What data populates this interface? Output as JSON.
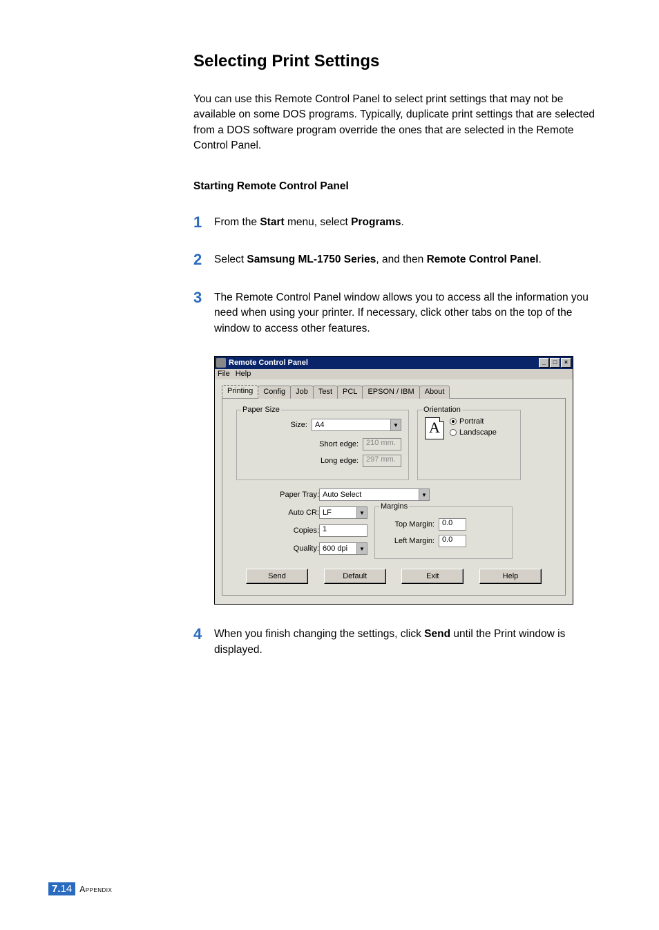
{
  "heading": "Selecting Print Settings",
  "intro": "You can use this Remote Control Panel to select print settings that may not be available on some DOS programs. Typically, duplicate print settings that are selected from a DOS software program override the ones that are selected in the Remote Control Panel.",
  "subheading": "Starting Remote Control Panel",
  "steps": {
    "s1": {
      "num": "1",
      "pre": "From the ",
      "b1": "Start",
      "mid": " menu, select ",
      "b2": "Programs",
      "post": "."
    },
    "s2": {
      "num": "2",
      "pre": "Select ",
      "b1": "Samsung ML-1750 Series",
      "mid": ", and then ",
      "b2": "Remote Control Panel",
      "post": "."
    },
    "s3": {
      "num": "3",
      "text": "The Remote Control Panel window allows you to access all the information you need when using your printer. If necessary, click other tabs on the top of the window to access other features."
    },
    "s4": {
      "num": "4",
      "pre": "When you finish changing the settings, click ",
      "b1": "Send",
      "post": " until the Print window is displayed."
    }
  },
  "rcp": {
    "title": "Remote Control Panel",
    "menu": {
      "file": "File",
      "help": "Help"
    },
    "tabs": [
      "Printing",
      "Config",
      "Job",
      "Test",
      "PCL",
      "EPSON / IBM",
      "About"
    ],
    "papersize": {
      "legend": "Paper Size",
      "size_label": "Size:",
      "size_value": "A4",
      "short_label": "Short edge:",
      "short_value": "210 mm.",
      "long_label": "Long edge:",
      "long_value": "297 mm."
    },
    "orientation": {
      "legend": "Orientation",
      "preview": "A",
      "portrait": "Portrait",
      "landscape": "Landscape"
    },
    "paper_tray": {
      "label": "Paper Tray:",
      "value": "Auto Select"
    },
    "auto_cr": {
      "label": "Auto CR:",
      "value": "LF"
    },
    "copies": {
      "label": "Copies:",
      "value": "1"
    },
    "quality": {
      "label": "Quality:",
      "value": "600 dpi"
    },
    "margins": {
      "legend": "Margins",
      "top_label": "Top Margin:",
      "top_value": "0.0",
      "left_label": "Left Margin:",
      "left_value": "0.0"
    },
    "buttons": {
      "send": "Send",
      "default": "Default",
      "exit": "Exit",
      "help": "Help"
    }
  },
  "footer": {
    "chapter": "7.",
    "page": "14",
    "label": "Appendix"
  }
}
